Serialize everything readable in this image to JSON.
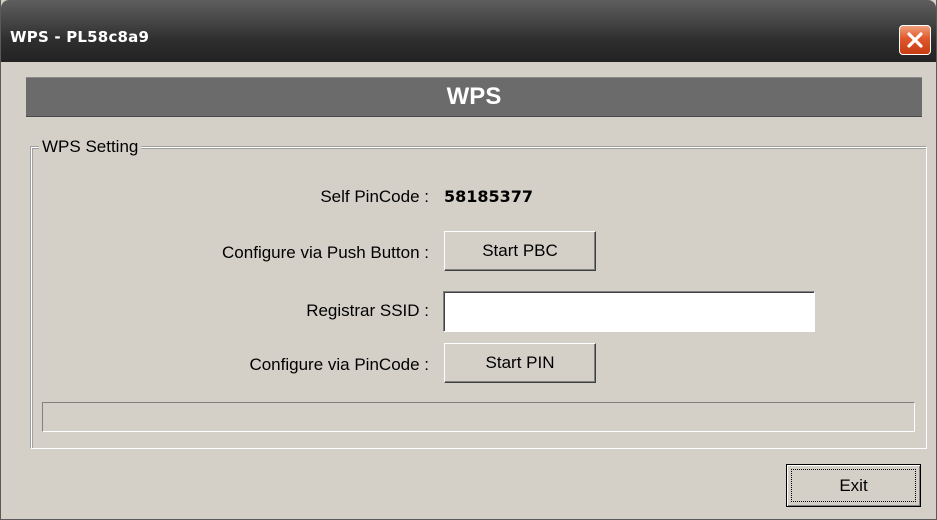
{
  "window": {
    "title": "WPS - PL58c8a9"
  },
  "header": {
    "title": "WPS"
  },
  "group": {
    "legend": "WPS Setting",
    "self_pincode_label": "Self PinCode :",
    "self_pincode_value": "58185377",
    "push_button_label": "Configure via Push Button :",
    "start_pbc_label": "Start PBC",
    "registrar_ssid_label": "Registrar SSID :",
    "registrar_ssid_value": "",
    "pincode_label": "Configure via PinCode :",
    "start_pin_label": "Start PIN"
  },
  "progress": {
    "value": 0
  },
  "footer": {
    "exit_label": "Exit"
  },
  "colors": {
    "titlebar": "#2e2e2e",
    "header_band": "#6b6b6b",
    "dialog_face": "#d4d0c8",
    "close_button": "#e0582c"
  },
  "icons": {
    "close": "close-icon"
  }
}
